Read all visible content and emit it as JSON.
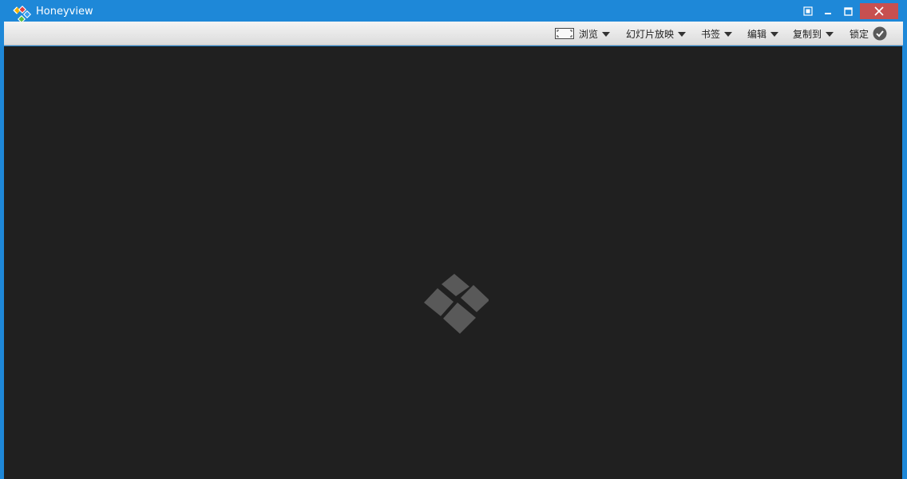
{
  "window": {
    "title": "Honeyview"
  },
  "toolbar": {
    "browse_label": "浏览",
    "slideshow_label": "幻灯片放映",
    "bookmark_label": "书签",
    "edit_label": "编辑",
    "copy_to_label": "复制到",
    "lock_label": "锁定"
  },
  "colors": {
    "titlebar": "#1e88d8",
    "close_button": "#c75050",
    "viewer_background": "#202020",
    "placeholder_logo": "#595959"
  },
  "icons": {
    "app": "honeyview-logo-icon",
    "fit": "fit-window-icon",
    "minimize": "minimize-icon",
    "maximize": "maximize-icon",
    "close": "close-icon",
    "browse": "browse-frame-icon",
    "lock": "check-circle-icon",
    "placeholder": "honeyview-placeholder-icon"
  }
}
